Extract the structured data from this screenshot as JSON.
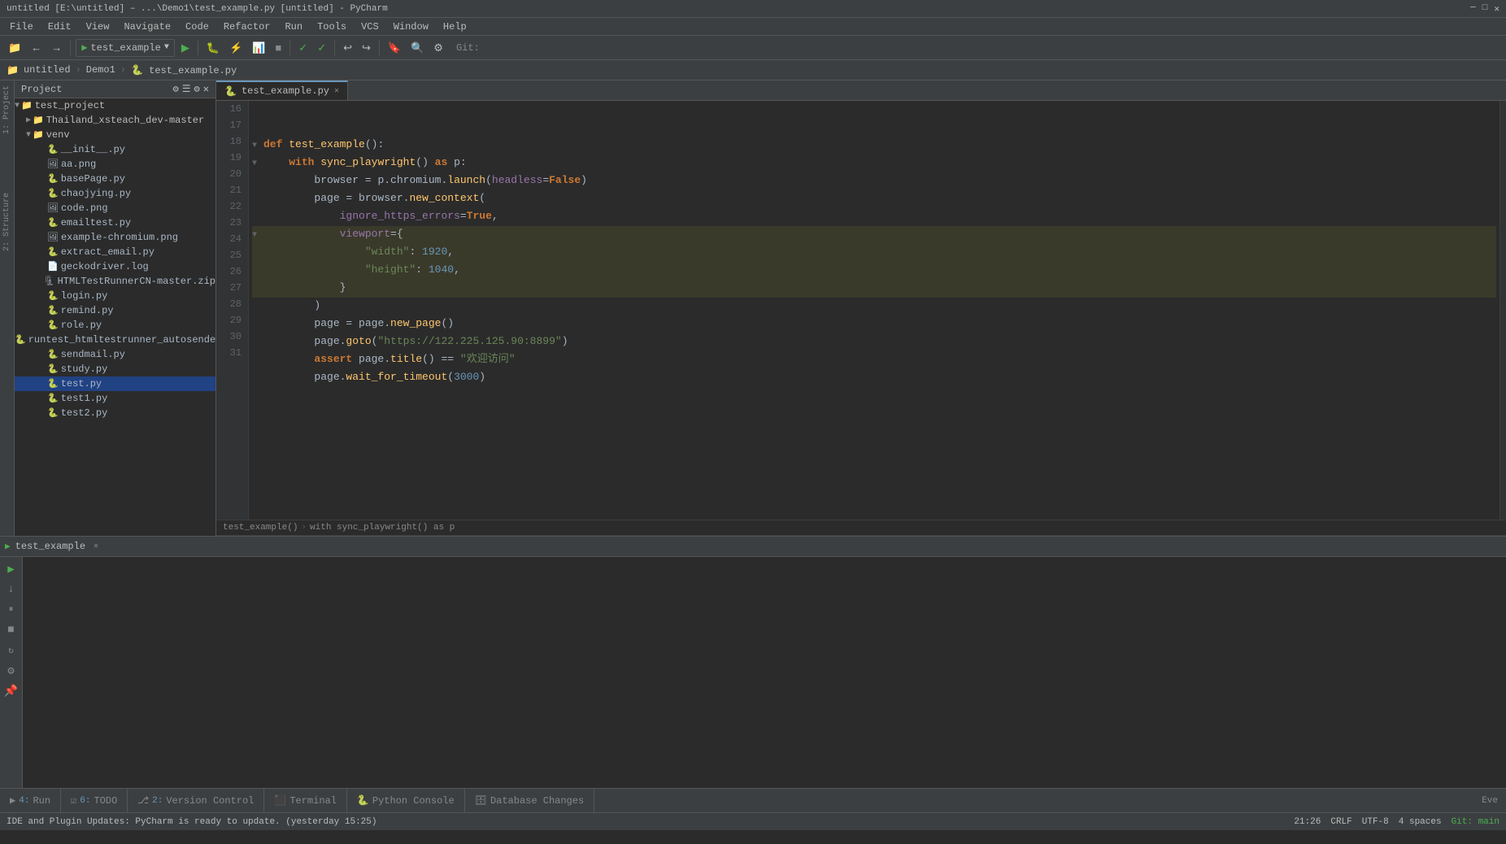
{
  "titleBar": {
    "text": "untitled [E:\\untitled] – ...\\Demo1\\test_example.py [untitled] - PyCharm"
  },
  "menuBar": {
    "items": [
      "File",
      "Edit",
      "View",
      "Navigate",
      "Code",
      "Refactor",
      "Run",
      "Tools",
      "VCS",
      "Window",
      "Help"
    ]
  },
  "toolbar": {
    "runConfig": "test_example",
    "gitLabel": "Git:"
  },
  "navBar": {
    "items": [
      "untitled",
      "Demo1",
      "test_example.py"
    ]
  },
  "project": {
    "title": "Project",
    "tree": [
      {
        "label": "test_project",
        "type": "folder",
        "indent": 0,
        "expanded": true
      },
      {
        "label": "Thailand_xsteach_dev-master",
        "type": "folder",
        "indent": 1,
        "expanded": false
      },
      {
        "label": "venv",
        "type": "folder",
        "indent": 1,
        "expanded": true
      },
      {
        "label": "__init__.py",
        "type": "py",
        "indent": 2
      },
      {
        "label": "aa.png",
        "type": "img",
        "indent": 2
      },
      {
        "label": "basePage.py",
        "type": "py",
        "indent": 2
      },
      {
        "label": "chaojying.py",
        "type": "py",
        "indent": 2
      },
      {
        "label": "code.png",
        "type": "img",
        "indent": 2
      },
      {
        "label": "emailtest.py",
        "type": "py",
        "indent": 2
      },
      {
        "label": "example-chromium.png",
        "type": "img",
        "indent": 2
      },
      {
        "label": "extract_email.py",
        "type": "py",
        "indent": 2
      },
      {
        "label": "geckodriver.log",
        "type": "log",
        "indent": 2
      },
      {
        "label": "HTMLTestRunnerCN-master.zip",
        "type": "zip",
        "indent": 2
      },
      {
        "label": "login.py",
        "type": "py",
        "indent": 2
      },
      {
        "label": "remind.py",
        "type": "py",
        "indent": 2
      },
      {
        "label": "role.py",
        "type": "py",
        "indent": 2
      },
      {
        "label": "runtest_htmltestrunner_autosendemail.py",
        "type": "py",
        "indent": 2
      },
      {
        "label": "sendmail.py",
        "type": "py",
        "indent": 2
      },
      {
        "label": "study.py",
        "type": "py",
        "indent": 2
      },
      {
        "label": "test.py",
        "type": "py",
        "indent": 2,
        "selected": true
      },
      {
        "label": "test1.py",
        "type": "py",
        "indent": 2
      },
      {
        "label": "test2.py",
        "type": "py",
        "indent": 2
      }
    ]
  },
  "editor": {
    "tab": "test_example.py",
    "lines": [
      {
        "num": 16,
        "content": "",
        "highlight": false
      },
      {
        "num": 17,
        "content": "",
        "highlight": false
      },
      {
        "num": 18,
        "content": "def test_example():",
        "highlight": false
      },
      {
        "num": 19,
        "content": "    with sync_playwright() as p:",
        "highlight": false
      },
      {
        "num": 20,
        "content": "        browser = p.chromium.launch(headless=False)",
        "highlight": false
      },
      {
        "num": 21,
        "content": "        page = browser.new_context(",
        "highlight": false
      },
      {
        "num": 22,
        "content": "            ignore_https_errors=True,",
        "highlight": false
      },
      {
        "num": 23,
        "content": "            viewport={",
        "highlight": true
      },
      {
        "num": 24,
        "content": "                \"width\": 1920,",
        "highlight": true
      },
      {
        "num": 25,
        "content": "                \"height\": 1040,",
        "highlight": true
      },
      {
        "num": 26,
        "content": "            }",
        "highlight": true
      },
      {
        "num": 27,
        "content": "        )",
        "highlight": false
      },
      {
        "num": 28,
        "content": "        page = page.new_page()",
        "highlight": false
      },
      {
        "num": 29,
        "content": "        page.goto(\"https://122.225.125.90:8899\")",
        "highlight": false
      },
      {
        "num": 30,
        "content": "        assert page.title() == \"欢迎访问\"",
        "highlight": false
      },
      {
        "num": 31,
        "content": "        page.wait_for_timeout(3000)",
        "highlight": false
      }
    ]
  },
  "breadcrumb": {
    "items": [
      "test_example()",
      "with sync_playwright() as p"
    ]
  },
  "runPanel": {
    "tabLabel": "test_example",
    "content": ""
  },
  "bottomTabs": [
    {
      "label": "Run",
      "num": "4",
      "icon": "▶"
    },
    {
      "label": "TODO",
      "num": "6",
      "icon": "☑"
    },
    {
      "label": "Version Control",
      "num": "2",
      "icon": "⎇"
    },
    {
      "label": "Terminal",
      "icon": "⬛"
    },
    {
      "label": "Python Console",
      "icon": "🐍"
    },
    {
      "label": "Database Changes",
      "icon": "🗄"
    }
  ],
  "statusBar": {
    "message": "IDE and Plugin Updates: PyCharm is ready to update. (yesterday 15:25)",
    "position": "21:26",
    "lineEnding": "CRLF",
    "encoding": "UTF-8",
    "indent": "4 spaces",
    "git": "Git: main",
    "event": "Eve"
  },
  "colors": {
    "bg": "#2b2b2b",
    "panel": "#3c3f41",
    "selected": "#214283",
    "highlight": "#3a3a2a",
    "accent": "#6897bb",
    "keyword": "#cc7832",
    "string": "#6a8759",
    "number": "#6897bb"
  }
}
